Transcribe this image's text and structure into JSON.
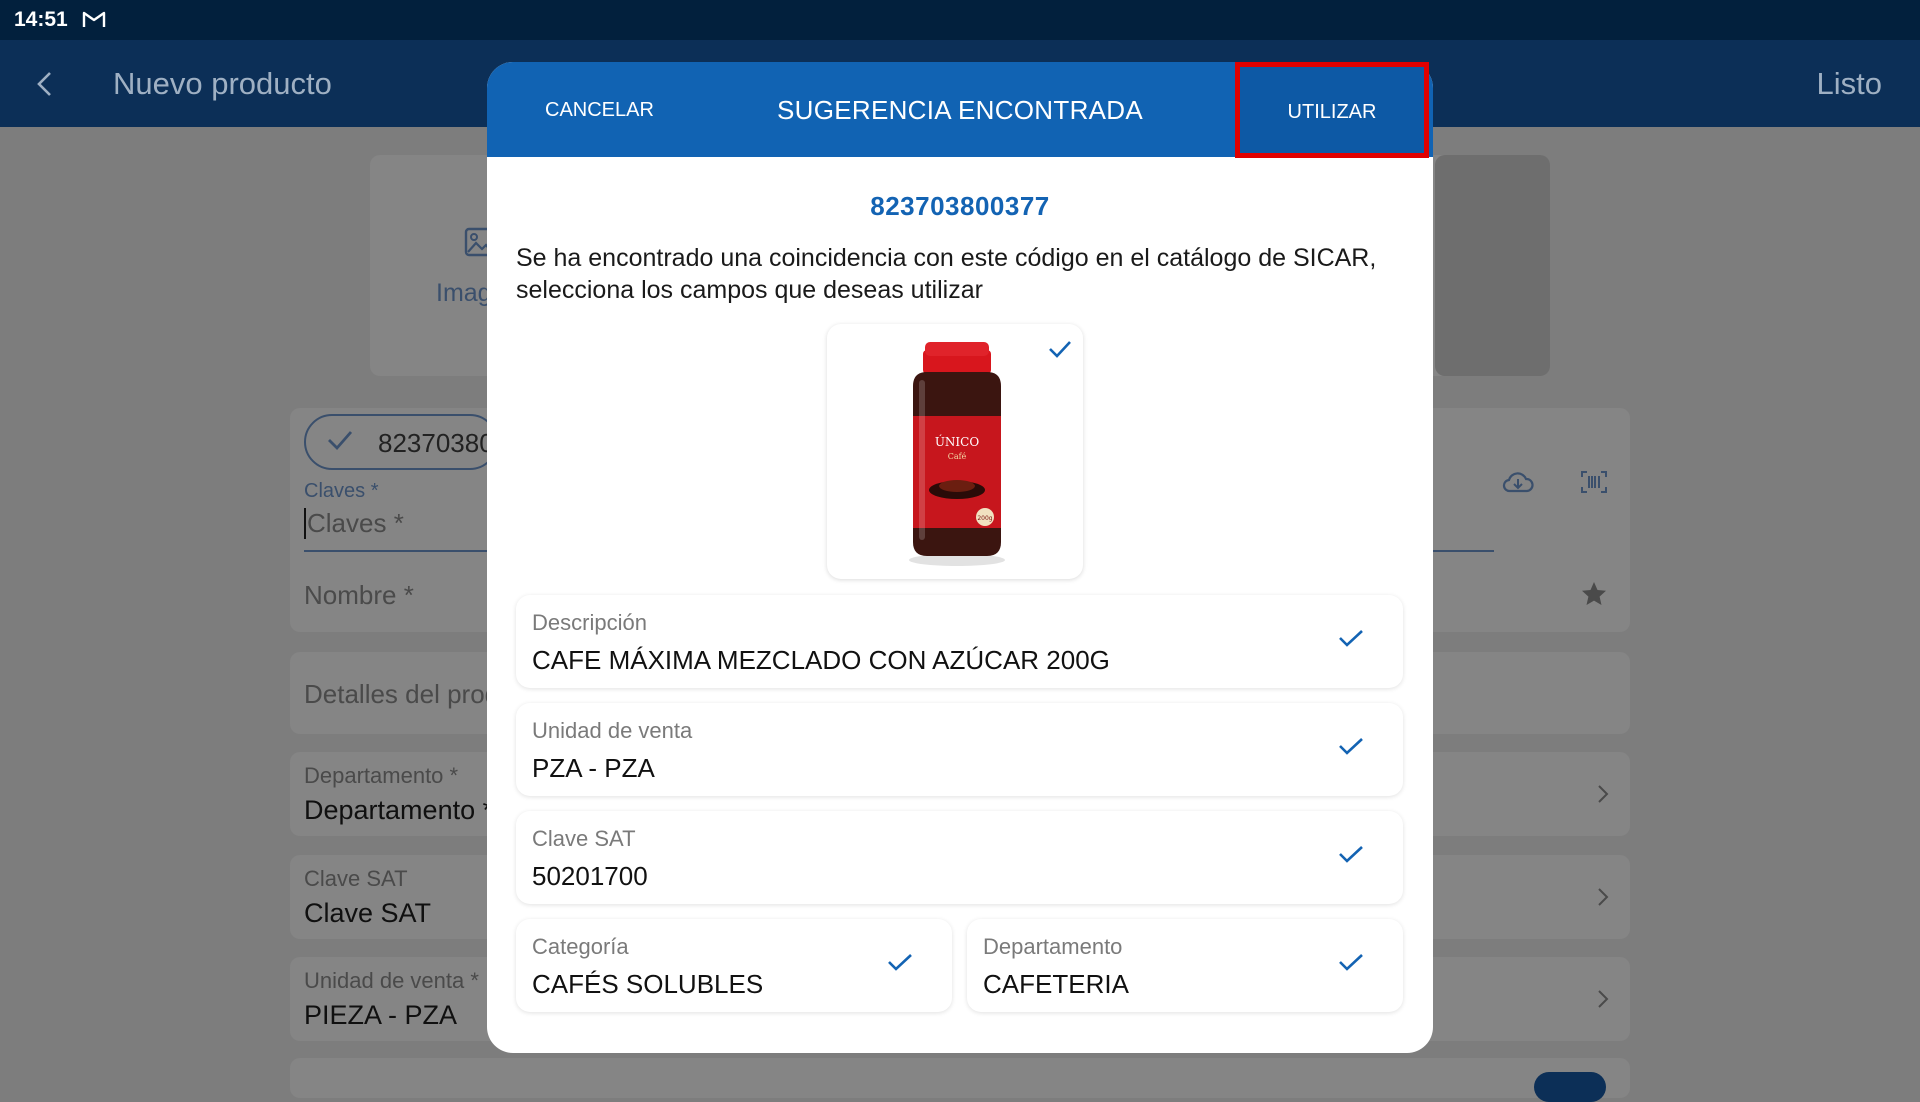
{
  "status_bar": {
    "time": "14:51",
    "notification_icon": "gmail-icon"
  },
  "app_bar": {
    "title": "Nuevo producto",
    "done_label": "Listo",
    "back_icon": "back-arrow-icon"
  },
  "background_form": {
    "image_label": "Imag",
    "barcode_chip": "82370380",
    "claves_label": "Claves *",
    "claves_placeholder": "Claves *",
    "nombre_placeholder": "Nombre *",
    "detalles_placeholder": "Detalles del prod",
    "departamento_label": "Departamento *",
    "departamento_value": "Departamento *",
    "clave_sat_label": "Clave SAT",
    "clave_sat_value": "Clave SAT",
    "unidad_label": "Unidad de venta *",
    "unidad_value": "PIEZA - PZA"
  },
  "modal": {
    "cancel_label": "CANCELAR",
    "title": "SUGERENCIA ENCONTRADA",
    "use_label": "UTILIZAR",
    "barcode": "823703800377",
    "message": "Se ha encontrado una coincidencia con este código en el catálogo de SICAR, selecciona los campos que deseas utilizar",
    "product_image": {
      "brand_text": "ÚNICO",
      "sub_text": "Café",
      "weight_text": "200g",
      "selected": true
    },
    "fields": {
      "descripcion": {
        "label": "Descripción",
        "value": "CAFE MÁXIMA MEZCLADO CON AZÚCAR 200G",
        "selected": true
      },
      "unidad": {
        "label": "Unidad de venta",
        "value": "PZA - PZA",
        "selected": true
      },
      "clave_sat": {
        "label": "Clave SAT",
        "value": "50201700",
        "selected": true
      },
      "categoria": {
        "label": "Categoría",
        "value": "CAFÉS SOLUBLES",
        "selected": true
      },
      "departamento": {
        "label": "Departamento",
        "value": "CAFETERIA",
        "selected": true
      }
    }
  },
  "colors": {
    "primary": "#1163b3",
    "status_bar": "#02203d",
    "app_bar": "#0c2f57",
    "highlight": "#e00000",
    "check": "#1363b3"
  }
}
